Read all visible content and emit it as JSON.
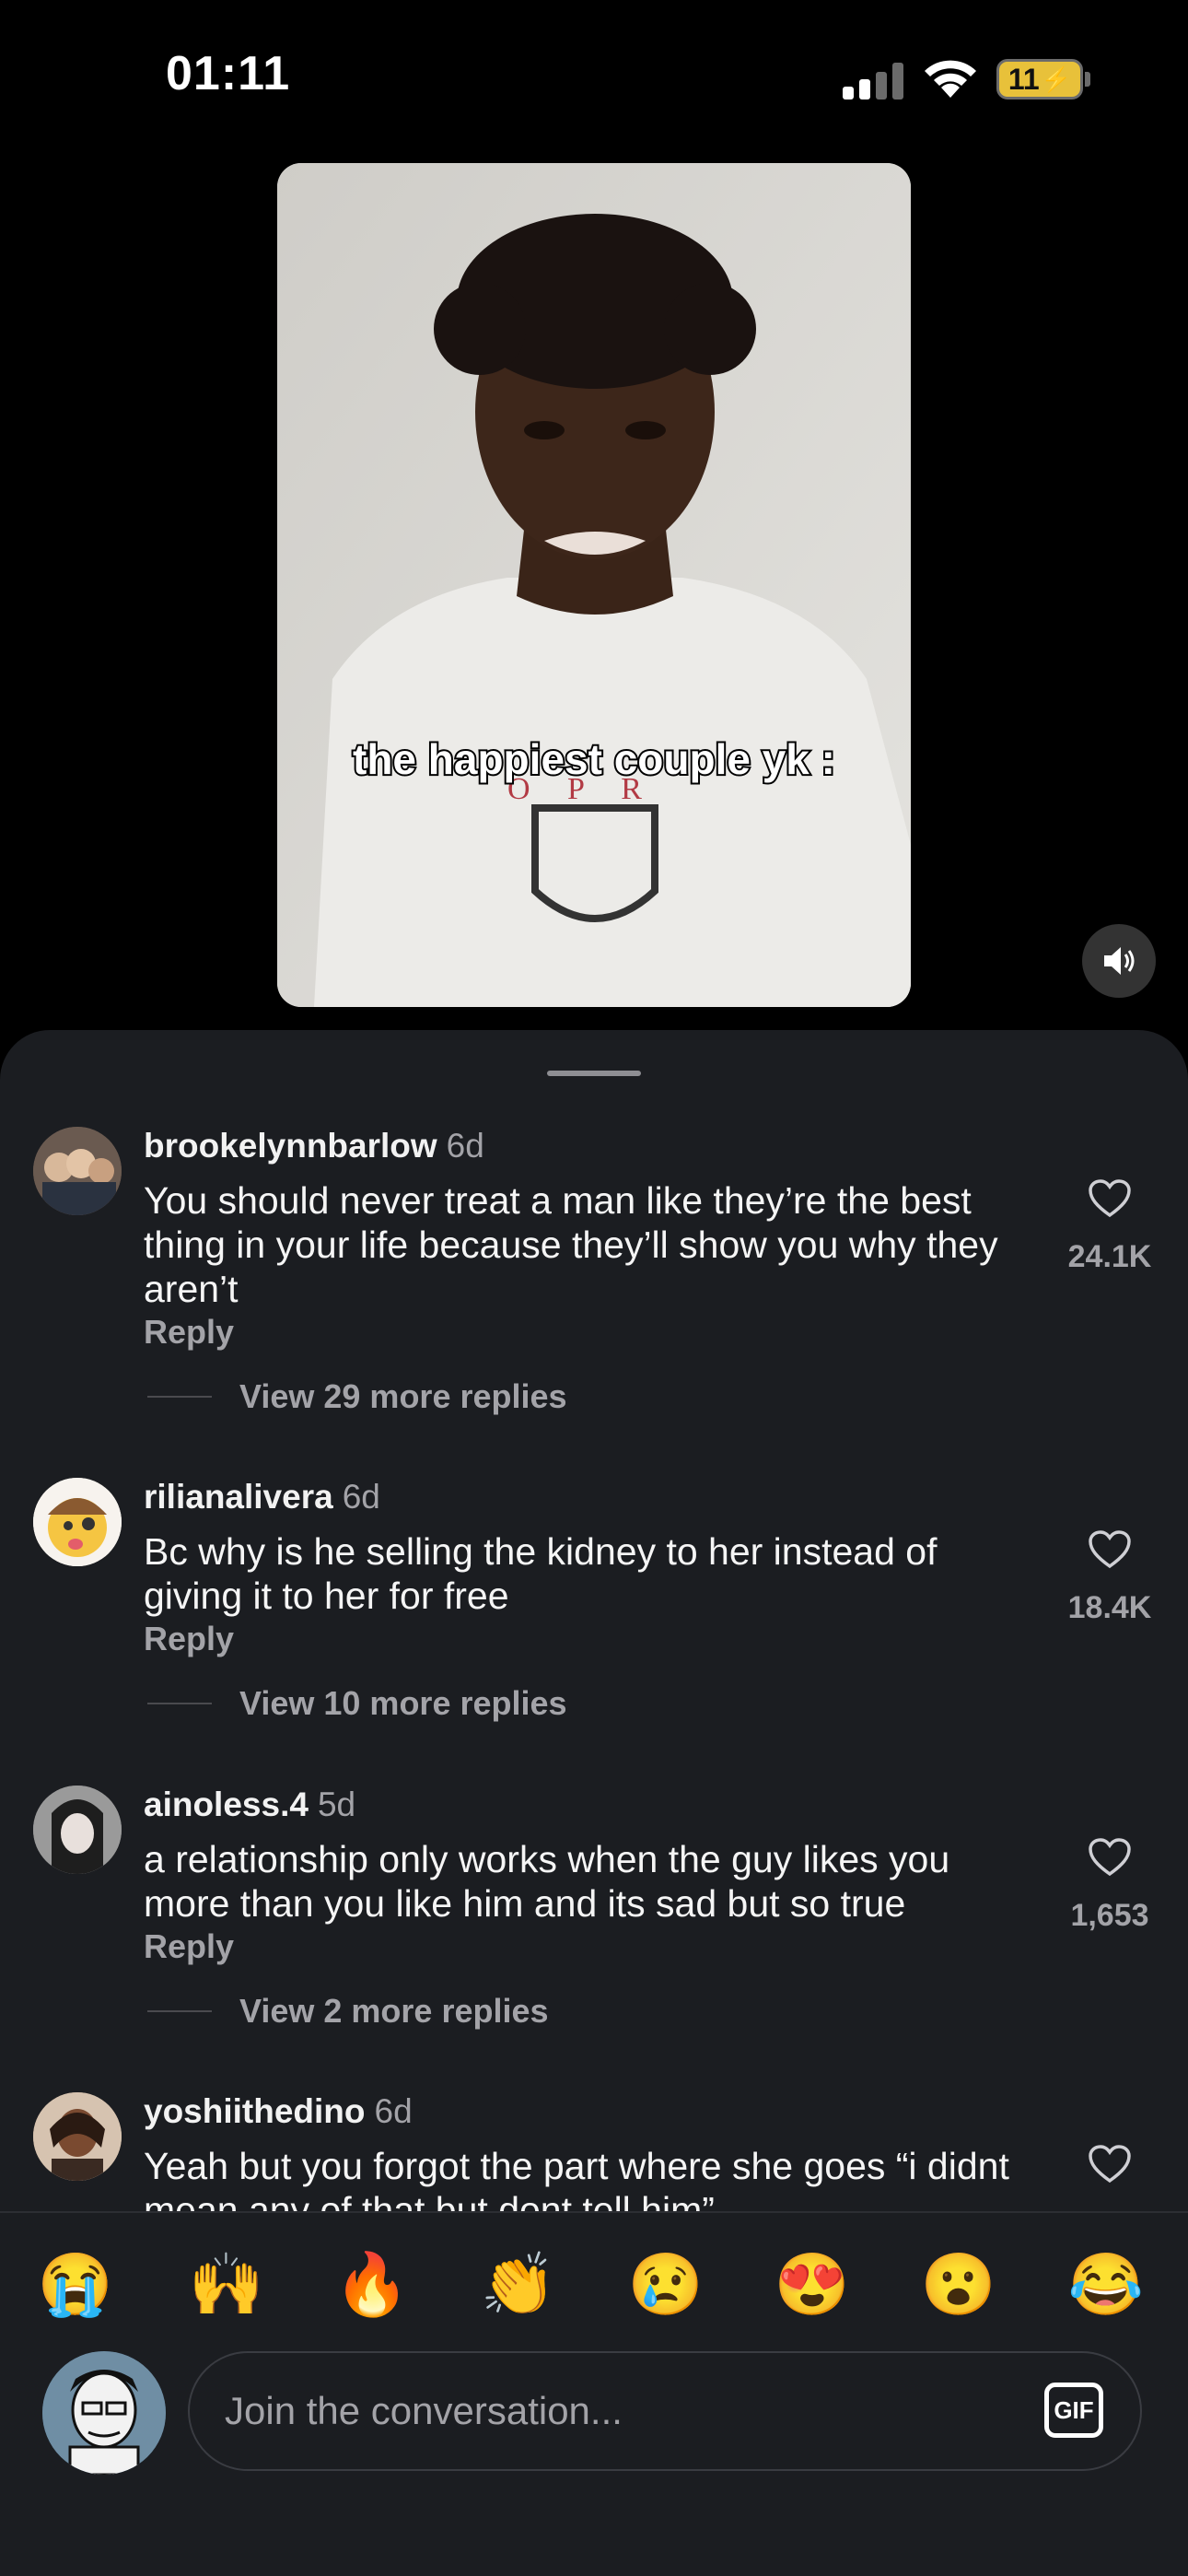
{
  "status_bar": {
    "time": "01:11",
    "battery": "11",
    "icons": [
      "signal-icon",
      "wifi-icon",
      "battery-charging-icon"
    ]
  },
  "video": {
    "caption": "the happiest couple yk :",
    "mute_icon": "speaker-icon"
  },
  "comments": [
    {
      "username": "brookelynnbarlow",
      "age": "6d",
      "text": "You should never treat a man like they’re the best thing in your life because they’ll show you why they aren’t",
      "reply": "Reply",
      "view_replies": "View 29 more replies",
      "likes": "24.1K"
    },
    {
      "username": "rilianalivera",
      "age": "6d",
      "text": "Bc why is he selling the kidney to her instead of giving it to her for free",
      "reply": "Reply",
      "view_replies": "View 10 more replies",
      "likes": "18.4K"
    },
    {
      "username": "ainoless.4",
      "age": "5d",
      "text": "a relationship only works when the guy likes you more than you like him and its sad but so true",
      "reply": "Reply",
      "view_replies": "View 2 more replies",
      "likes": "1,653"
    },
    {
      "username": "yoshiithedino",
      "age": "6d",
      "text": "Yeah but you forgot the part where she goes “i didnt mean any of that but dont tell him”",
      "reply": "",
      "view_replies": "",
      "likes": ""
    }
  ],
  "emoji_bar": [
    "😭",
    "🙌",
    "🔥",
    "👏",
    "😢",
    "😍",
    "😮",
    "😂"
  ],
  "compose": {
    "placeholder": "Join the conversation...",
    "gif_label": "GIF"
  },
  "colors": {
    "sheet_bg": "#1b1d21",
    "secondary_text": "#a3a3a8",
    "battery": "#e8c13a"
  }
}
